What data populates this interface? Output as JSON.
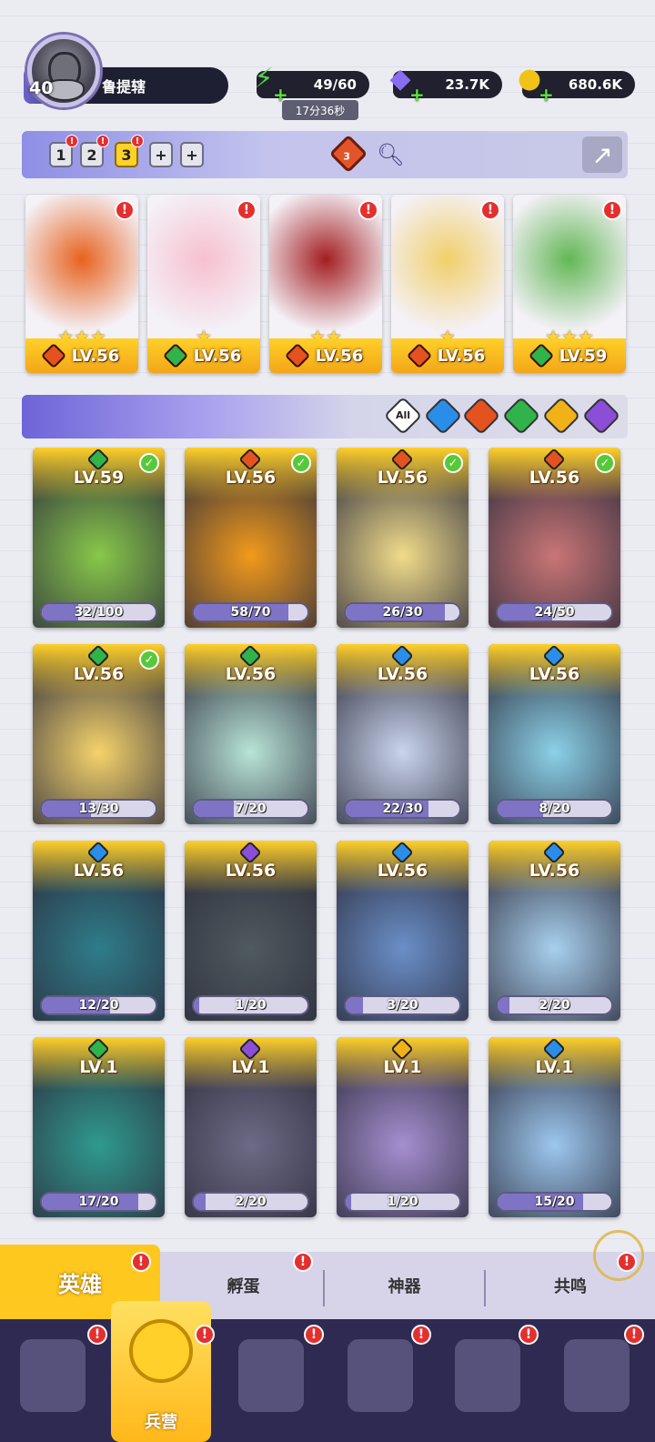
{
  "player": {
    "level": "40",
    "name": "鲁提辖"
  },
  "resources": {
    "energy": {
      "value": "49/60",
      "timer": "17分36秒",
      "icon": "lightning-icon",
      "color": "#4fd64a"
    },
    "gems": {
      "value": "23.7K",
      "icon": "diamond-icon",
      "color": "#8a6cf0"
    },
    "gold": {
      "value": "680.6K",
      "icon": "coin-icon",
      "color": "#f2c218"
    }
  },
  "teams": {
    "tabs": [
      "1",
      "2",
      "3",
      "+",
      "+"
    ],
    "active": "3",
    "element_count": "3"
  },
  "team_heroes": [
    {
      "level": "LV.56",
      "element": "fire",
      "stars": "★★★",
      "color": "#e7621d"
    },
    {
      "level": "LV.56",
      "element": "wood",
      "stars": "★",
      "color": "#f7c0cf"
    },
    {
      "level": "LV.56",
      "element": "fire",
      "stars": "★★",
      "color": "#a31e20"
    },
    {
      "level": "LV.56",
      "element": "fire",
      "stars": "★",
      "color": "#f2cf6a"
    },
    {
      "level": "LV.59",
      "element": "wood",
      "stars": "★★★",
      "color": "#62b755"
    }
  ],
  "filters": [
    "All",
    "water",
    "fire",
    "wood",
    "light",
    "dark"
  ],
  "heroes": [
    {
      "level": "LV.59",
      "element": "wood",
      "progress": "32/100",
      "ratio": 0.32,
      "check": true,
      "color": "#88c84a"
    },
    {
      "level": "LV.56",
      "element": "fire",
      "progress": "58/70",
      "ratio": 0.83,
      "check": true,
      "color": "#f29a1b"
    },
    {
      "level": "LV.56",
      "element": "fire",
      "progress": "26/30",
      "ratio": 0.87,
      "check": true,
      "color": "#f1dc8a"
    },
    {
      "level": "LV.56",
      "element": "fire",
      "progress": "24/50",
      "ratio": 0.48,
      "check": true,
      "color": "#c97575"
    },
    {
      "level": "LV.56",
      "element": "wood",
      "progress": "13/30",
      "ratio": 0.43,
      "check": true,
      "color": "#f5d36b"
    },
    {
      "level": "LV.56",
      "element": "wood",
      "progress": "7/20",
      "ratio": 0.35,
      "check": false,
      "color": "#b8e4d6"
    },
    {
      "level": "LV.56",
      "element": "water",
      "progress": "22/30",
      "ratio": 0.73,
      "check": false,
      "color": "#c9d5ec"
    },
    {
      "level": "LV.56",
      "element": "water",
      "progress": "8/20",
      "ratio": 0.4,
      "check": false,
      "color": "#8bd1e8"
    },
    {
      "level": "LV.56",
      "element": "water",
      "progress": "12/20",
      "ratio": 0.6,
      "check": false,
      "color": "#2e7d8a"
    },
    {
      "level": "LV.56",
      "element": "dark",
      "progress": "1/20",
      "ratio": 0.05,
      "check": false,
      "color": "#4f5a5e"
    },
    {
      "level": "LV.56",
      "element": "water",
      "progress": "3/20",
      "ratio": 0.15,
      "check": false,
      "color": "#6a8fc8"
    },
    {
      "level": "LV.56",
      "element": "water",
      "progress": "2/20",
      "ratio": 0.1,
      "check": false,
      "color": "#a8d0ee"
    },
    {
      "level": "LV.1",
      "element": "wood",
      "progress": "17/20",
      "ratio": 0.85,
      "check": false,
      "color": "#2f9a8f"
    },
    {
      "level": "LV.1",
      "element": "dark",
      "progress": "2/20",
      "ratio": 0.1,
      "check": false,
      "color": "#6d6b85"
    },
    {
      "level": "LV.1",
      "element": "light",
      "progress": "1/20",
      "ratio": 0.05,
      "check": false,
      "color": "#a58fd0"
    },
    {
      "level": "LV.1",
      "element": "water",
      "progress": "15/20",
      "ratio": 0.75,
      "check": false,
      "color": "#9cc7ee"
    }
  ],
  "element_colors": {
    "fire": "#e4521f",
    "wood": "#2fb34a",
    "water": "#2a8ee8",
    "light": "#f0b216",
    "dark": "#8a4fd6"
  },
  "subtabs": [
    "英雄",
    "孵蛋",
    "神器",
    "共鸣"
  ],
  "nav": {
    "active_label": "兵营"
  }
}
